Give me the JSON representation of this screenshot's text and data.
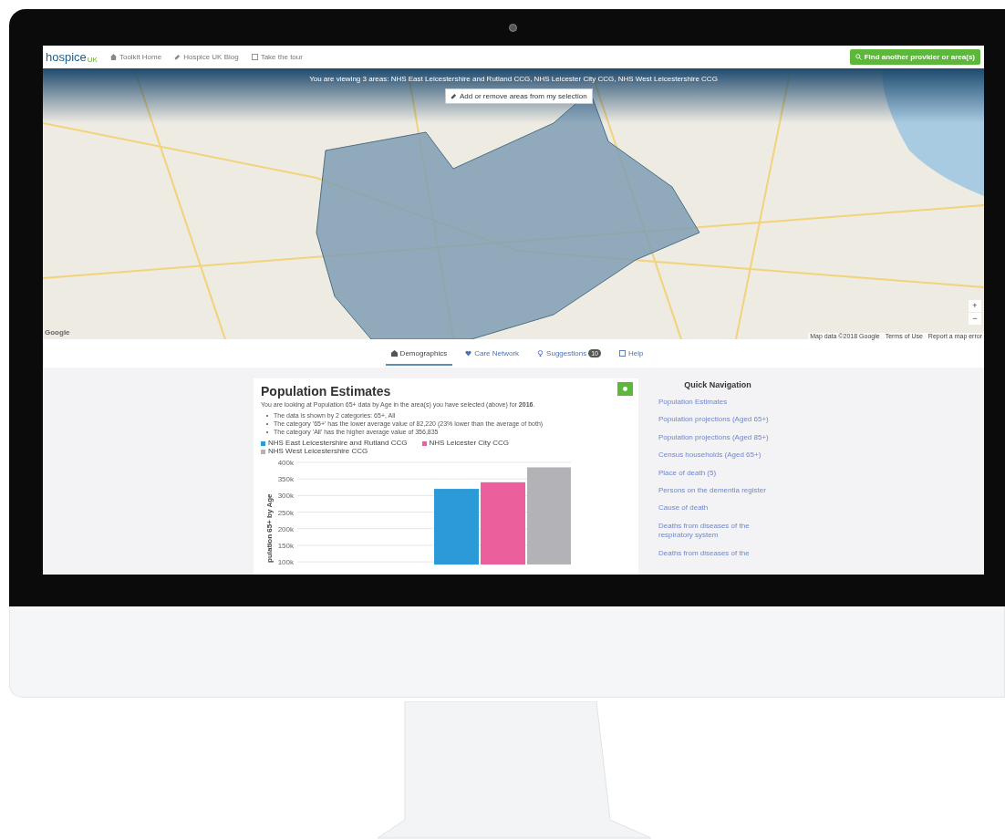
{
  "site_header": {
    "logo": "hospice",
    "logo_suffix": "UK",
    "nav_links": [
      {
        "kind": "home",
        "label": "Toolkit Home"
      },
      {
        "kind": "blog",
        "label": "Hospice UK Blog"
      },
      {
        "kind": "tour",
        "label": "Take the tour"
      }
    ],
    "search_button": "Find another provider or area(s)"
  },
  "map": {
    "viewing_text": "You are viewing 3 areas: NHS East Leicestershire and Rutland CCG, NHS Leicester City CCG, NHS West Leicestershire CCG",
    "edit_button": "Add or remove areas from my selection",
    "zoom_in": "+",
    "zoom_out": "−",
    "google_logo": "Google",
    "attribution": [
      "Map data ©2018 Google",
      "Terms of Use",
      "Report a map error"
    ]
  },
  "tabs": [
    {
      "kind": "demographics",
      "label": "Demographics",
      "selected": true
    },
    {
      "kind": "network",
      "label": "Care Network",
      "selected": false
    },
    {
      "kind": "suggestions",
      "label": "Suggestions",
      "badge": "10",
      "selected": false
    },
    {
      "kind": "help",
      "label": "Help",
      "selected": false
    }
  ],
  "panel": {
    "title": "Population Estimates",
    "intro": "You are looking at Population 65+ data by Age in the area(s) you have selected (above) for **2016**.",
    "bullets": [
      "The data is shown by 2 categories: 65+, All",
      "The category '65+' has the lower average value of 82,220 (23% lower than the average of both)",
      "The category 'All' has the higher average value of 356,835"
    ],
    "chart_data": {
      "type": "bar",
      "ylabel": "pulation 65+ by Age",
      "grid": true,
      "ylim": [
        92000,
        400000
      ],
      "yticks": [
        {
          "value": 100000,
          "label": "100k"
        },
        {
          "value": 150000,
          "label": "150k"
        },
        {
          "value": 200000,
          "label": "200k"
        },
        {
          "value": 250000,
          "label": "250k"
        },
        {
          "value": 300000,
          "label": "300k"
        },
        {
          "value": 350000,
          "label": "350k"
        },
        {
          "value": 400000,
          "label": "400k"
        }
      ],
      "series": [
        {
          "name": "NHS East Leicestershire and Rutland CCG",
          "color": "#2b9ad6",
          "values": [
            320000
          ]
        },
        {
          "name": "NHS Leicester City CCG",
          "color": "#ea5f9c",
          "values": [
            340000
          ]
        },
        {
          "name": "NHS West Leicestershire CCG",
          "color": "#b3b2b6",
          "values": [
            385000
          ]
        }
      ]
    }
  },
  "quick_navigation": {
    "title": "Quick Navigation",
    "links": [
      "Population Estimates",
      "Population projections (Aged 65+)",
      "Population projections (Aged 85+)",
      "Census households (Aged 65+)",
      "Place of death (5)",
      "Persons on the dementia register",
      "Cause of death",
      "Deaths from diseases of the respiratory system",
      "Deaths from diseases of the"
    ]
  }
}
